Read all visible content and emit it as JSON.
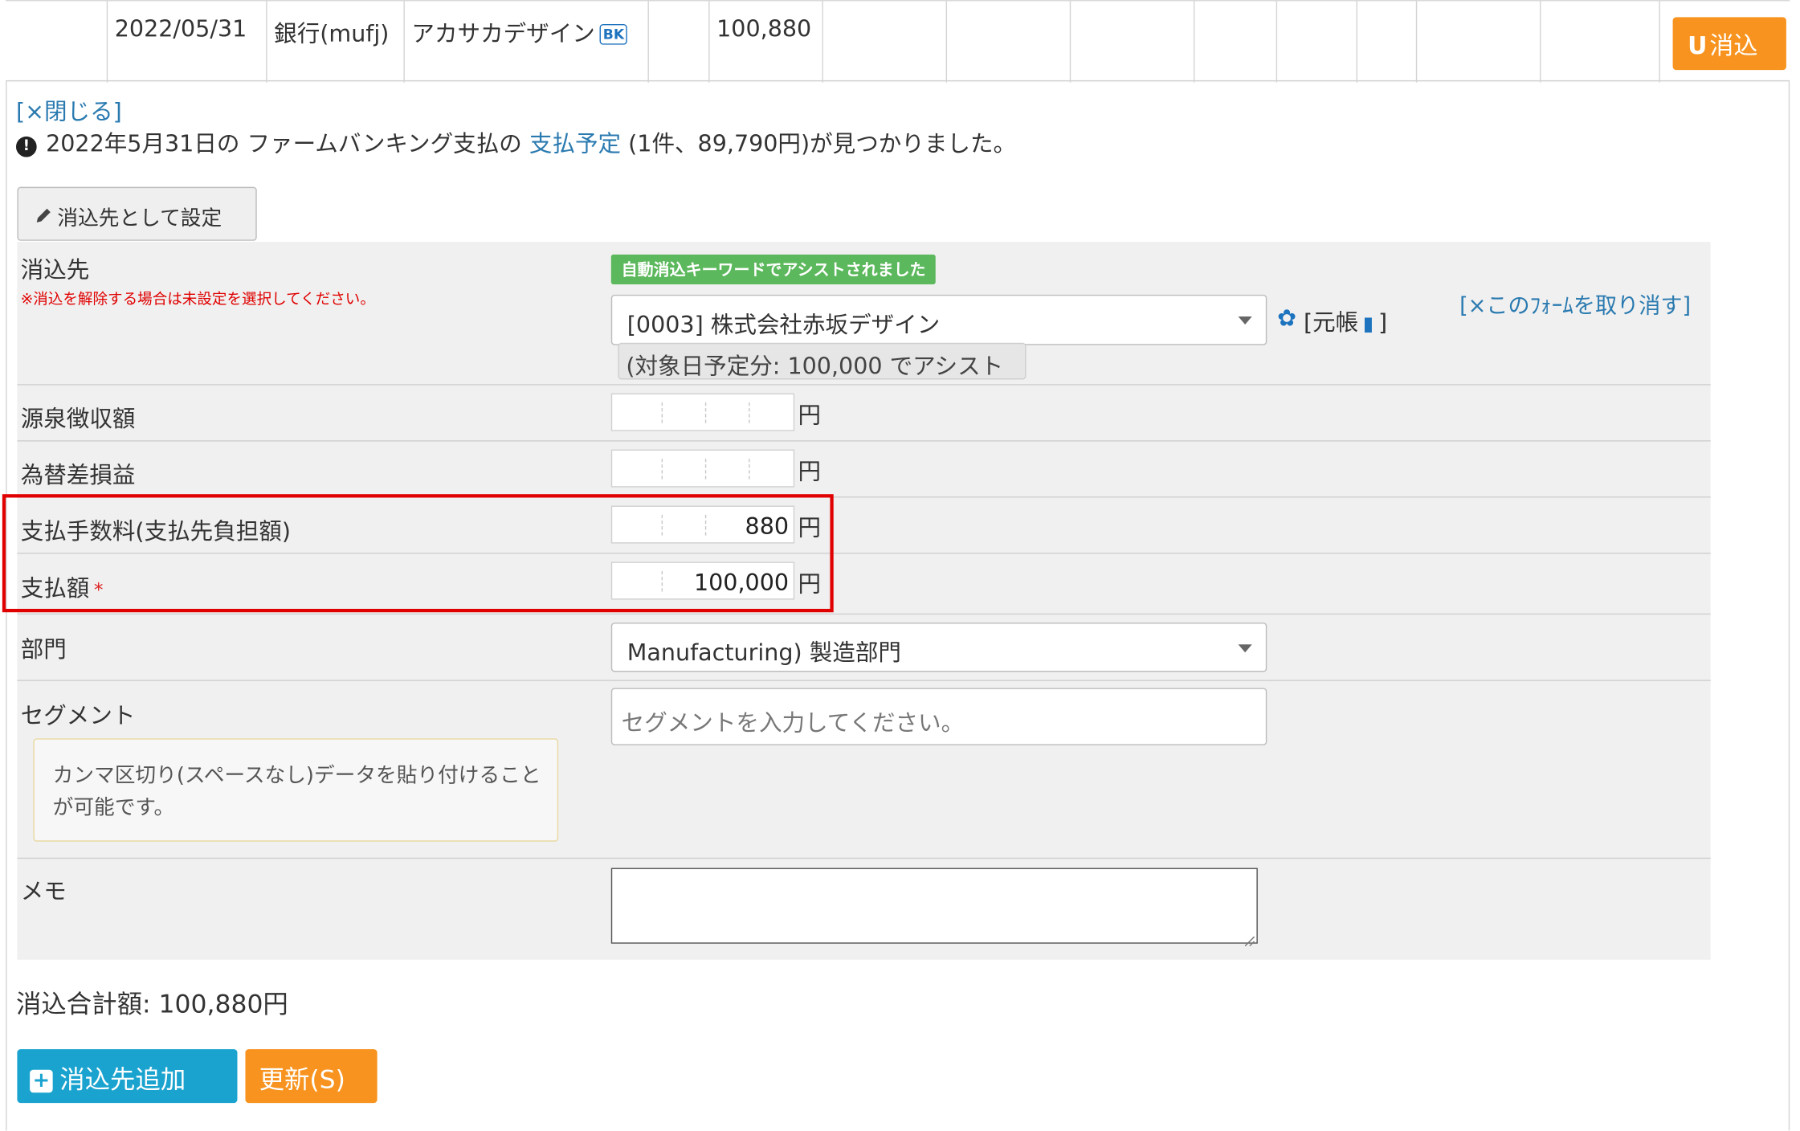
{
  "top_row": {
    "date": "2022/05/31",
    "account": "銀行(mufj)",
    "description": "アカサカデザイン",
    "badge": "BK",
    "amount": "100,880",
    "reconcile_icon": "U",
    "reconcile_label": "消込"
  },
  "panel": {
    "close_link": "[×閉じる]",
    "notice_icon": "!",
    "notice_prefix": "2022年5月31日の ファームバンキング支払の ",
    "notice_link": "支払予定",
    "notice_suffix": " (1件、89,790円)が見つかりました。",
    "set_target_button": "消込先として設定",
    "set_target_icon": "pencil-icon"
  },
  "form": {
    "target": {
      "label": "消込先",
      "warning": "※消込を解除する場合は未設定を選択してください。",
      "assist_badge": "自動消込キーワードでアシストされました",
      "selected": "[0003] 株式会社赤坂デザイン",
      "assist_hint": "(対象日予定分: 100,000 でアシスト",
      "ledger_open": "[元帳",
      "ledger_close": "]",
      "cancel_form": "[×このﾌｫｰﾑを取り消す]"
    },
    "withholding": {
      "label": "源泉徴収額",
      "value": "",
      "unit": "円"
    },
    "fx_gain_loss": {
      "label": "為替差損益",
      "value": "",
      "unit": "円"
    },
    "fee": {
      "label": "支払手数料(支払先負担額)",
      "value": "880",
      "unit": "円"
    },
    "payment": {
      "label": "支払額",
      "required_mark": "*",
      "value": "100,000",
      "unit": "円"
    },
    "department": {
      "label": "部門",
      "selected": "Manufacturing) 製造部門"
    },
    "segment": {
      "label": "セグメント",
      "placeholder": "セグメントを入力してください。",
      "hint": "カンマ区切り(スペースなし)データを貼り付けることが可能です。"
    },
    "memo": {
      "label": "メモ",
      "value": ""
    }
  },
  "footer": {
    "total": "消込合計額: 100,880円",
    "add_target_button": "消込先追加",
    "update_button": "更新(S)"
  },
  "colors": {
    "accent_orange": "#f7931e",
    "accent_blue": "#1aa3cf",
    "link": "#2a7ab0",
    "highlight": "#e00000",
    "assist_green": "#5cb85c"
  }
}
